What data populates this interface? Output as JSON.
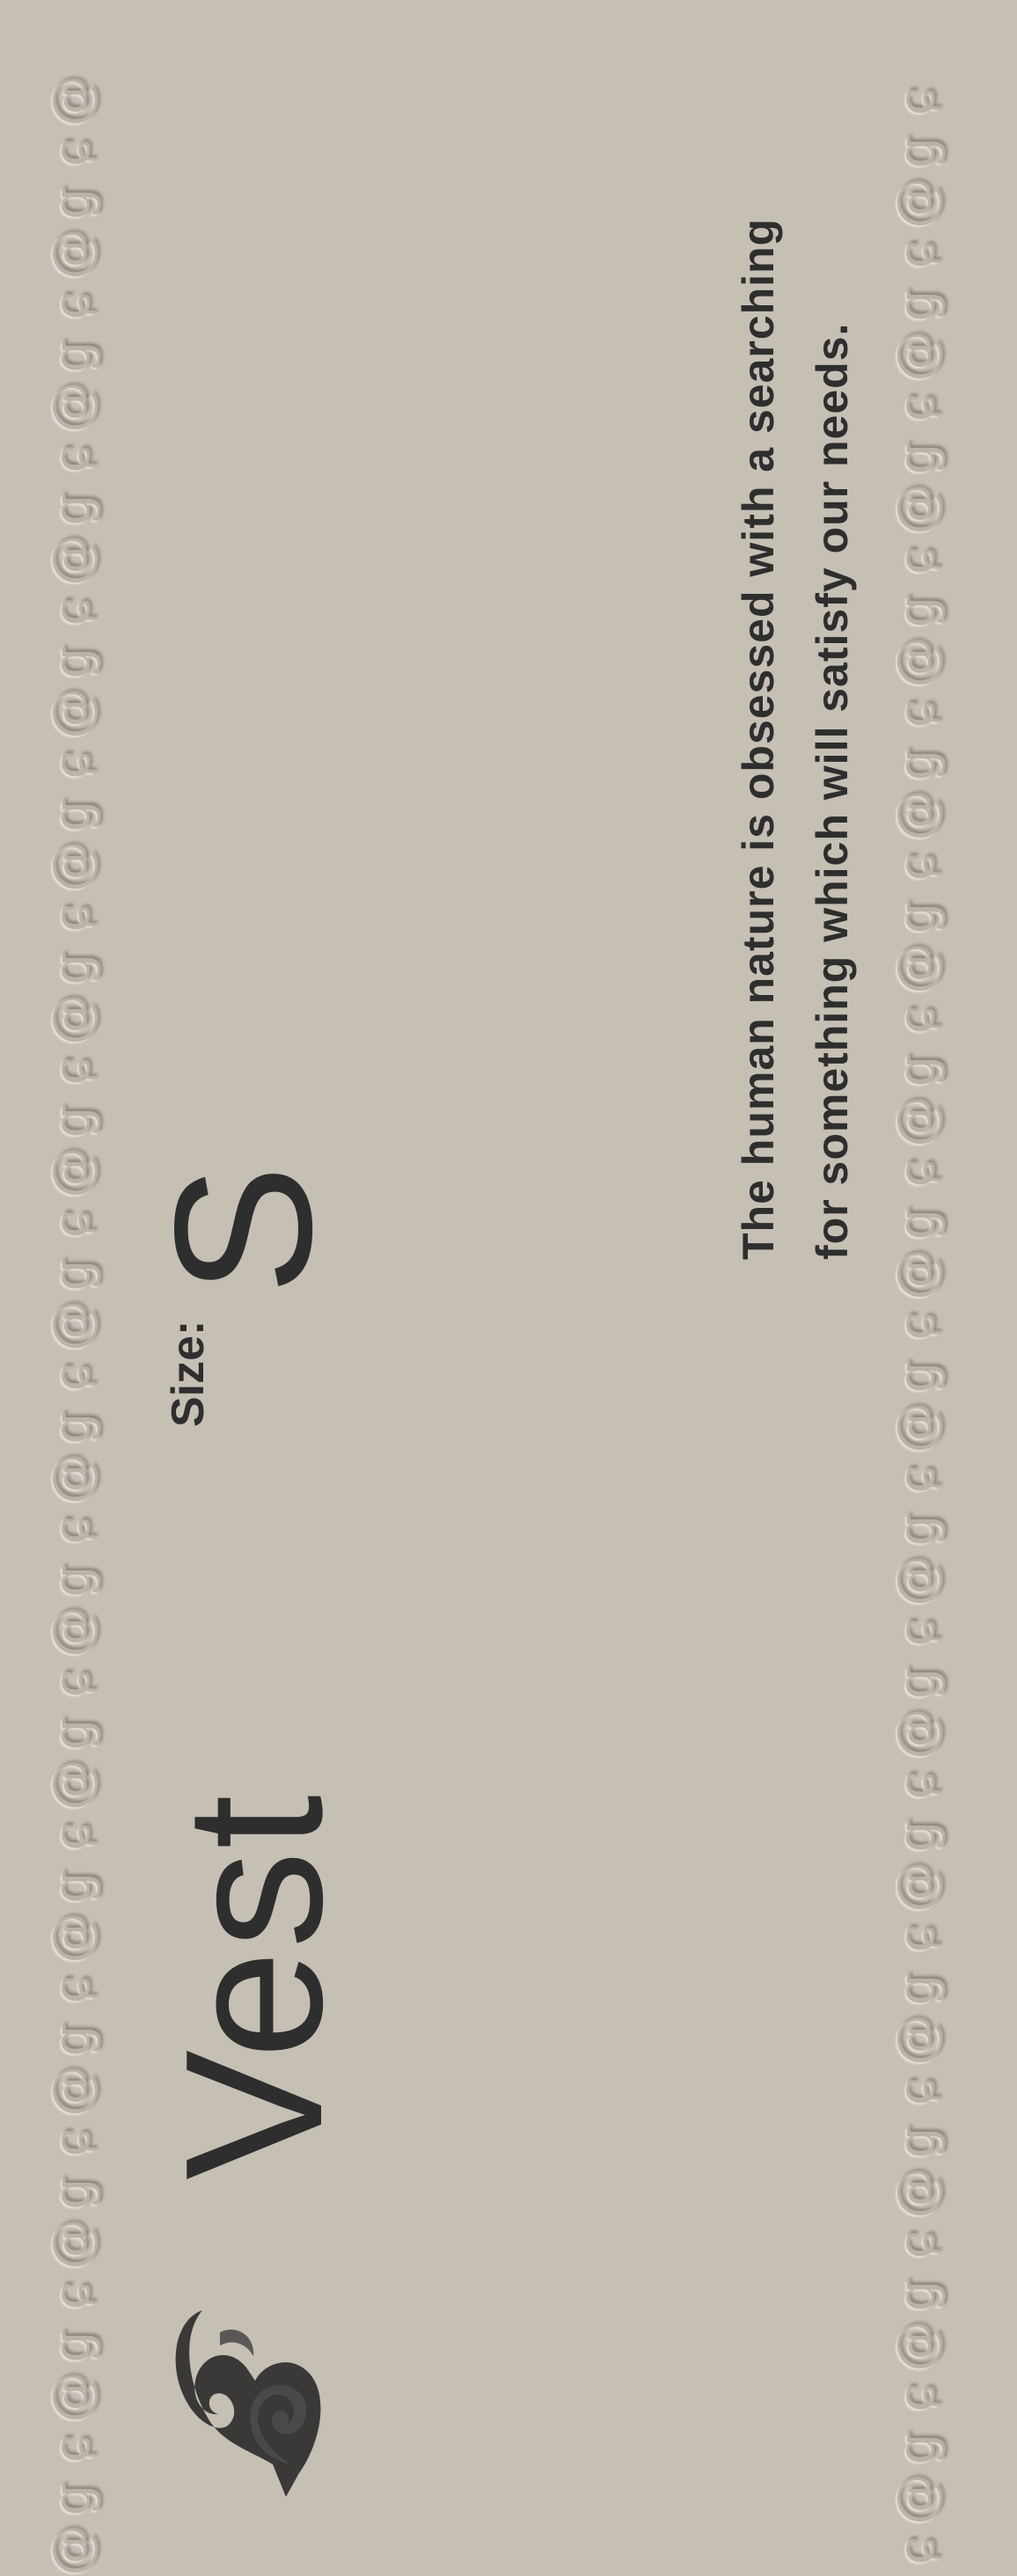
{
  "product": {
    "title": "Vest",
    "size_label": "Size:",
    "size_value": "S"
  },
  "tagline": {
    "line1": "The human nature is obsessed with a searching",
    "line2": "for something which will satisfy our needs."
  },
  "decor": {
    "border_glyphs": [
      "@",
      "ɕ",
      "ց"
    ],
    "logo_icon": "swirl-heart-logo-icon"
  },
  "colors": {
    "background": "#c6bfb4",
    "text": "#2e2e2e",
    "embossed_glyph": "#bbb3a7"
  }
}
